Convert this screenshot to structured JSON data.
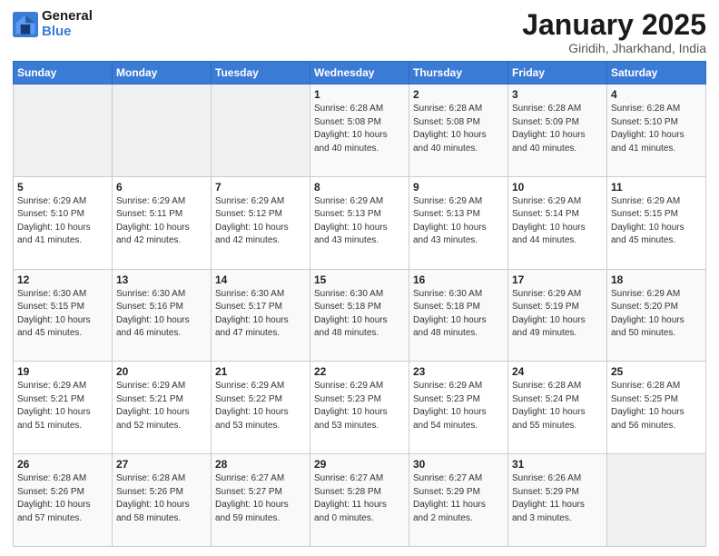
{
  "header": {
    "logo_line1": "General",
    "logo_line2": "Blue",
    "title": "January 2025",
    "subtitle": "Giridih, Jharkhand, India"
  },
  "weekdays": [
    "Sunday",
    "Monday",
    "Tuesday",
    "Wednesday",
    "Thursday",
    "Friday",
    "Saturday"
  ],
  "weeks": [
    [
      {
        "day": "",
        "info": ""
      },
      {
        "day": "",
        "info": ""
      },
      {
        "day": "",
        "info": ""
      },
      {
        "day": "1",
        "info": "Sunrise: 6:28 AM\nSunset: 5:08 PM\nDaylight: 10 hours\nand 40 minutes."
      },
      {
        "day": "2",
        "info": "Sunrise: 6:28 AM\nSunset: 5:08 PM\nDaylight: 10 hours\nand 40 minutes."
      },
      {
        "day": "3",
        "info": "Sunrise: 6:28 AM\nSunset: 5:09 PM\nDaylight: 10 hours\nand 40 minutes."
      },
      {
        "day": "4",
        "info": "Sunrise: 6:28 AM\nSunset: 5:10 PM\nDaylight: 10 hours\nand 41 minutes."
      }
    ],
    [
      {
        "day": "5",
        "info": "Sunrise: 6:29 AM\nSunset: 5:10 PM\nDaylight: 10 hours\nand 41 minutes."
      },
      {
        "day": "6",
        "info": "Sunrise: 6:29 AM\nSunset: 5:11 PM\nDaylight: 10 hours\nand 42 minutes."
      },
      {
        "day": "7",
        "info": "Sunrise: 6:29 AM\nSunset: 5:12 PM\nDaylight: 10 hours\nand 42 minutes."
      },
      {
        "day": "8",
        "info": "Sunrise: 6:29 AM\nSunset: 5:13 PM\nDaylight: 10 hours\nand 43 minutes."
      },
      {
        "day": "9",
        "info": "Sunrise: 6:29 AM\nSunset: 5:13 PM\nDaylight: 10 hours\nand 43 minutes."
      },
      {
        "day": "10",
        "info": "Sunrise: 6:29 AM\nSunset: 5:14 PM\nDaylight: 10 hours\nand 44 minutes."
      },
      {
        "day": "11",
        "info": "Sunrise: 6:29 AM\nSunset: 5:15 PM\nDaylight: 10 hours\nand 45 minutes."
      }
    ],
    [
      {
        "day": "12",
        "info": "Sunrise: 6:30 AM\nSunset: 5:15 PM\nDaylight: 10 hours\nand 45 minutes."
      },
      {
        "day": "13",
        "info": "Sunrise: 6:30 AM\nSunset: 5:16 PM\nDaylight: 10 hours\nand 46 minutes."
      },
      {
        "day": "14",
        "info": "Sunrise: 6:30 AM\nSunset: 5:17 PM\nDaylight: 10 hours\nand 47 minutes."
      },
      {
        "day": "15",
        "info": "Sunrise: 6:30 AM\nSunset: 5:18 PM\nDaylight: 10 hours\nand 48 minutes."
      },
      {
        "day": "16",
        "info": "Sunrise: 6:30 AM\nSunset: 5:18 PM\nDaylight: 10 hours\nand 48 minutes."
      },
      {
        "day": "17",
        "info": "Sunrise: 6:29 AM\nSunset: 5:19 PM\nDaylight: 10 hours\nand 49 minutes."
      },
      {
        "day": "18",
        "info": "Sunrise: 6:29 AM\nSunset: 5:20 PM\nDaylight: 10 hours\nand 50 minutes."
      }
    ],
    [
      {
        "day": "19",
        "info": "Sunrise: 6:29 AM\nSunset: 5:21 PM\nDaylight: 10 hours\nand 51 minutes."
      },
      {
        "day": "20",
        "info": "Sunrise: 6:29 AM\nSunset: 5:21 PM\nDaylight: 10 hours\nand 52 minutes."
      },
      {
        "day": "21",
        "info": "Sunrise: 6:29 AM\nSunset: 5:22 PM\nDaylight: 10 hours\nand 53 minutes."
      },
      {
        "day": "22",
        "info": "Sunrise: 6:29 AM\nSunset: 5:23 PM\nDaylight: 10 hours\nand 53 minutes."
      },
      {
        "day": "23",
        "info": "Sunrise: 6:29 AM\nSunset: 5:23 PM\nDaylight: 10 hours\nand 54 minutes."
      },
      {
        "day": "24",
        "info": "Sunrise: 6:28 AM\nSunset: 5:24 PM\nDaylight: 10 hours\nand 55 minutes."
      },
      {
        "day": "25",
        "info": "Sunrise: 6:28 AM\nSunset: 5:25 PM\nDaylight: 10 hours\nand 56 minutes."
      }
    ],
    [
      {
        "day": "26",
        "info": "Sunrise: 6:28 AM\nSunset: 5:26 PM\nDaylight: 10 hours\nand 57 minutes."
      },
      {
        "day": "27",
        "info": "Sunrise: 6:28 AM\nSunset: 5:26 PM\nDaylight: 10 hours\nand 58 minutes."
      },
      {
        "day": "28",
        "info": "Sunrise: 6:27 AM\nSunset: 5:27 PM\nDaylight: 10 hours\nand 59 minutes."
      },
      {
        "day": "29",
        "info": "Sunrise: 6:27 AM\nSunset: 5:28 PM\nDaylight: 11 hours\nand 0 minutes."
      },
      {
        "day": "30",
        "info": "Sunrise: 6:27 AM\nSunset: 5:29 PM\nDaylight: 11 hours\nand 2 minutes."
      },
      {
        "day": "31",
        "info": "Sunrise: 6:26 AM\nSunset: 5:29 PM\nDaylight: 11 hours\nand 3 minutes."
      },
      {
        "day": "",
        "info": ""
      }
    ]
  ]
}
